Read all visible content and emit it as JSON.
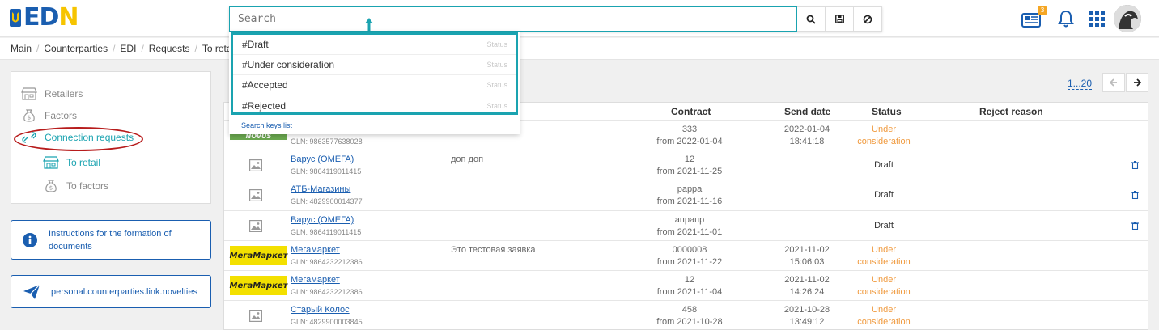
{
  "header": {
    "logo": {
      "e": "E",
      "d": "D",
      "n": "N"
    },
    "search_placeholder": "Search",
    "notifications_badge": "3"
  },
  "search_dropdown": {
    "items": [
      {
        "key": "#Draft",
        "tag": "Status"
      },
      {
        "key": "#Under consideration",
        "tag": "Status"
      },
      {
        "key": "#Accepted",
        "tag": "Status"
      },
      {
        "key": "#Rejected",
        "tag": "Status"
      }
    ],
    "footer": "Search keys list"
  },
  "breadcrumb": [
    "Main",
    "Counterparties",
    "EDI",
    "Requests",
    "To retail"
  ],
  "sidebar": {
    "items": [
      {
        "label": "Retailers",
        "icon": "store-icon"
      },
      {
        "label": "Factors",
        "icon": "money-bag-icon"
      },
      {
        "label": "Connection requests",
        "icon": "link-icon"
      },
      {
        "label": "To retail",
        "icon": "store-icon"
      },
      {
        "label": "To factors",
        "icon": "money-bag-icon"
      }
    ],
    "instructions": "Instructions for the formation of documents",
    "novelties": "personal.counterparties.link.novelties"
  },
  "pagination": {
    "range": "1...20"
  },
  "table": {
    "columns": {
      "contract": "Contract",
      "send_date": "Send date",
      "status": "Status",
      "reject_reason": "Reject reason"
    },
    "rows": [
      {
        "logo": "novus",
        "logo_text": "NOVUS",
        "name": "",
        "gln": "GLN: 9863577638028",
        "comment": "",
        "contract": "333",
        "contract_from": "from 2022-01-04",
        "date": "2022-01-04",
        "time": "18:41:18",
        "status1": "Under",
        "status2": "consideration"
      },
      {
        "logo": "none",
        "name": "Варус (ОМЕГА)",
        "gln": "GLN: 9864119011415",
        "comment": "доп доп",
        "contract": "12",
        "contract_from": "from 2021-11-25",
        "date": "",
        "time": "",
        "status1": "Draft",
        "status2": ""
      },
      {
        "logo": "none",
        "name": "АТБ-Магазины",
        "gln": "GLN: 4829900014377",
        "comment": "",
        "contract": "рарра",
        "contract_from": "from 2021-11-16",
        "date": "",
        "time": "",
        "status1": "Draft",
        "status2": ""
      },
      {
        "logo": "none",
        "name": "Варус (ОМЕГА)",
        "gln": "GLN: 9864119011415",
        "comment": "",
        "contract": "апрапр",
        "contract_from": "from 2021-11-01",
        "date": "",
        "time": "",
        "status1": "Draft",
        "status2": ""
      },
      {
        "logo": "mega",
        "logo_text": "МегаМаркет",
        "name": "Мегамаркет",
        "gln": "GLN: 9864232212386",
        "comment": "Это тестовая заявка",
        "contract": "0000008",
        "contract_from": "from 2021-11-22",
        "date": "2021-11-02",
        "time": "15:06:03",
        "status1": "Under",
        "status2": "consideration"
      },
      {
        "logo": "mega",
        "logo_text": "МегаМаркет",
        "name": "Мегамаркет",
        "gln": "GLN: 9864232212386",
        "comment": "",
        "contract": "12",
        "contract_from": "from 2021-11-04",
        "date": "2021-11-02",
        "time": "14:26:24",
        "status1": "Under",
        "status2": "consideration"
      },
      {
        "logo": "none",
        "name": "Старый Колос",
        "gln": "GLN: 4829900003845",
        "comment": "",
        "contract": "458",
        "contract_from": "from 2021-10-28",
        "date": "2021-10-28",
        "time": "13:49:12",
        "status1": "Under",
        "status2": "consideration"
      }
    ]
  },
  "colors": {
    "accent": "#1aa3b0",
    "link": "#1a5eb0",
    "under": "#f09a3e",
    "annotation": "#b71c1c"
  }
}
